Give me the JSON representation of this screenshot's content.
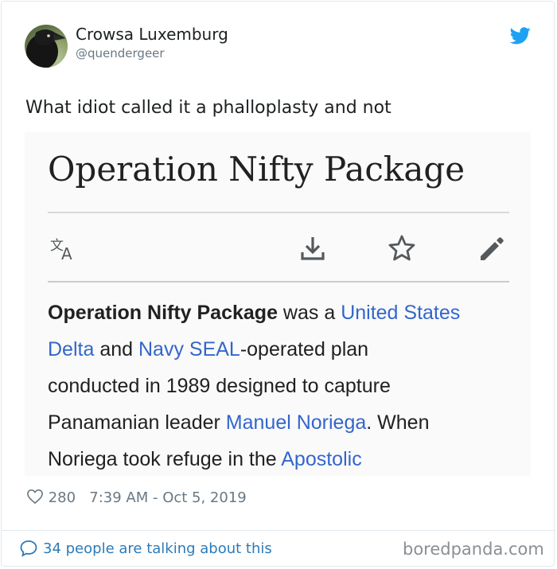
{
  "tweet": {
    "author_name": "Crowsa Luxemburg",
    "author_handle": "@quendergeer",
    "text": "What idiot called it a phalloplasty and not",
    "likes": "280",
    "timestamp": "7:39 AM - Oct 5, 2019",
    "conversation_link": "34 people are talking about this"
  },
  "embedded_screenshot": {
    "title": "Operation Nifty Package",
    "toolbar_icons": [
      "translate-icon",
      "download-icon",
      "star-icon",
      "edit-pencil-icon"
    ],
    "body_lines": [
      [
        {
          "text": "Operation Nifty Package",
          "style": "bold"
        },
        {
          "text": " was a ",
          "style": "plain"
        },
        {
          "text": "United States",
          "style": "link"
        }
      ],
      [
        {
          "text": "Delta",
          "style": "link"
        },
        {
          "text": " and ",
          "style": "plain"
        },
        {
          "text": "Navy SEAL",
          "style": "link"
        },
        {
          "text": "-operated plan",
          "style": "plain"
        }
      ],
      [
        {
          "text": "conducted in 1989 designed to capture",
          "style": "plain"
        }
      ],
      [
        {
          "text": "Panamanian leader ",
          "style": "plain"
        },
        {
          "text": "Manuel Noriega",
          "style": "link"
        },
        {
          "text": ". When",
          "style": "plain"
        }
      ],
      [
        {
          "text": "Noriega took refuge in the ",
          "style": "plain"
        },
        {
          "text": "Apostolic",
          "style": "link"
        }
      ]
    ]
  },
  "watermark": "boredpanda.com",
  "colors": {
    "link": "#3366cc",
    "twitter_blue": "#1da1f2",
    "meta_grey": "#697882",
    "conversation_blue": "#2b7bb9"
  }
}
